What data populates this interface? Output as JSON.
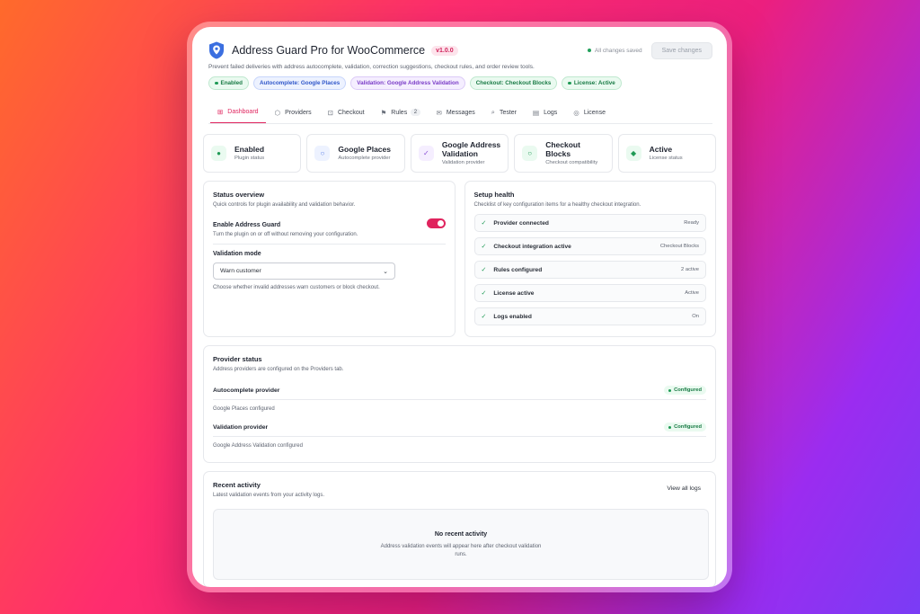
{
  "app": {
    "title": "Address Guard Pro for WooCommerce",
    "version": "v1.0.0",
    "saved_status": "All changes saved",
    "save_label": "Save changes",
    "subtitle": "Prevent failed deliveries with address autocomplete, validation, correction suggestions, checkout rules, and order review tools."
  },
  "badges": [
    {
      "label": "Enabled"
    },
    {
      "label": "Autocomplete: Google Places"
    },
    {
      "label": "Validation: Google Address Validation"
    },
    {
      "label": "Checkout: Checkout Blocks"
    },
    {
      "label": "License: Active"
    }
  ],
  "tabs": [
    {
      "label": "Dashboard"
    },
    {
      "label": "Providers"
    },
    {
      "label": "Checkout"
    },
    {
      "label": "Rules",
      "count": "2"
    },
    {
      "label": "Messages"
    },
    {
      "label": "Tester"
    },
    {
      "label": "Logs"
    },
    {
      "label": "License"
    }
  ],
  "stats": [
    {
      "title": "Enabled",
      "sub": "Plugin status"
    },
    {
      "title": "Google Places",
      "sub": "Autocomplete provider"
    },
    {
      "title": "Google Address Validation",
      "sub": "Validation provider"
    },
    {
      "title": "Checkout Blocks",
      "sub": "Checkout compatibility"
    },
    {
      "title": "Active",
      "sub": "License status"
    }
  ],
  "status_overview": {
    "title": "Status overview",
    "sub": "Quick controls for plugin availability and validation behavior.",
    "enable_title": "Enable Address Guard",
    "enable_sub": "Turn the plugin on or off without removing your configuration.",
    "mode_title": "Validation mode",
    "mode_value": "Warn customer",
    "mode_hint": "Choose whether invalid addresses warn customers or block checkout."
  },
  "setup_health": {
    "title": "Setup health",
    "sub": "Checklist of key configuration items for a healthy checkout integration.",
    "items": [
      {
        "label": "Provider connected",
        "value": "Ready"
      },
      {
        "label": "Checkout integration active",
        "value": "Checkout Blocks"
      },
      {
        "label": "Rules configured",
        "value": "2 active"
      },
      {
        "label": "License active",
        "value": "Active"
      },
      {
        "label": "Logs enabled",
        "value": "On"
      }
    ]
  },
  "provider_status": {
    "title": "Provider status",
    "sub": "Address providers are configured on the Providers tab.",
    "autocomplete_label": "Autocomplete provider",
    "autocomplete_badge": "Configured",
    "autocomplete_desc": "Google Places configured",
    "validation_label": "Validation provider",
    "validation_badge": "Configured",
    "validation_desc": "Google Address Validation configured"
  },
  "recent_activity": {
    "title": "Recent activity",
    "sub": "Latest validation events from your activity logs.",
    "view_all": "View all logs",
    "empty_title": "No recent activity",
    "empty_sub_1": "Address validation events will appear here after checkout validation",
    "empty_sub_2": "runs."
  },
  "colors": {
    "accent": "#e0245e",
    "success": "#1f9a55"
  }
}
